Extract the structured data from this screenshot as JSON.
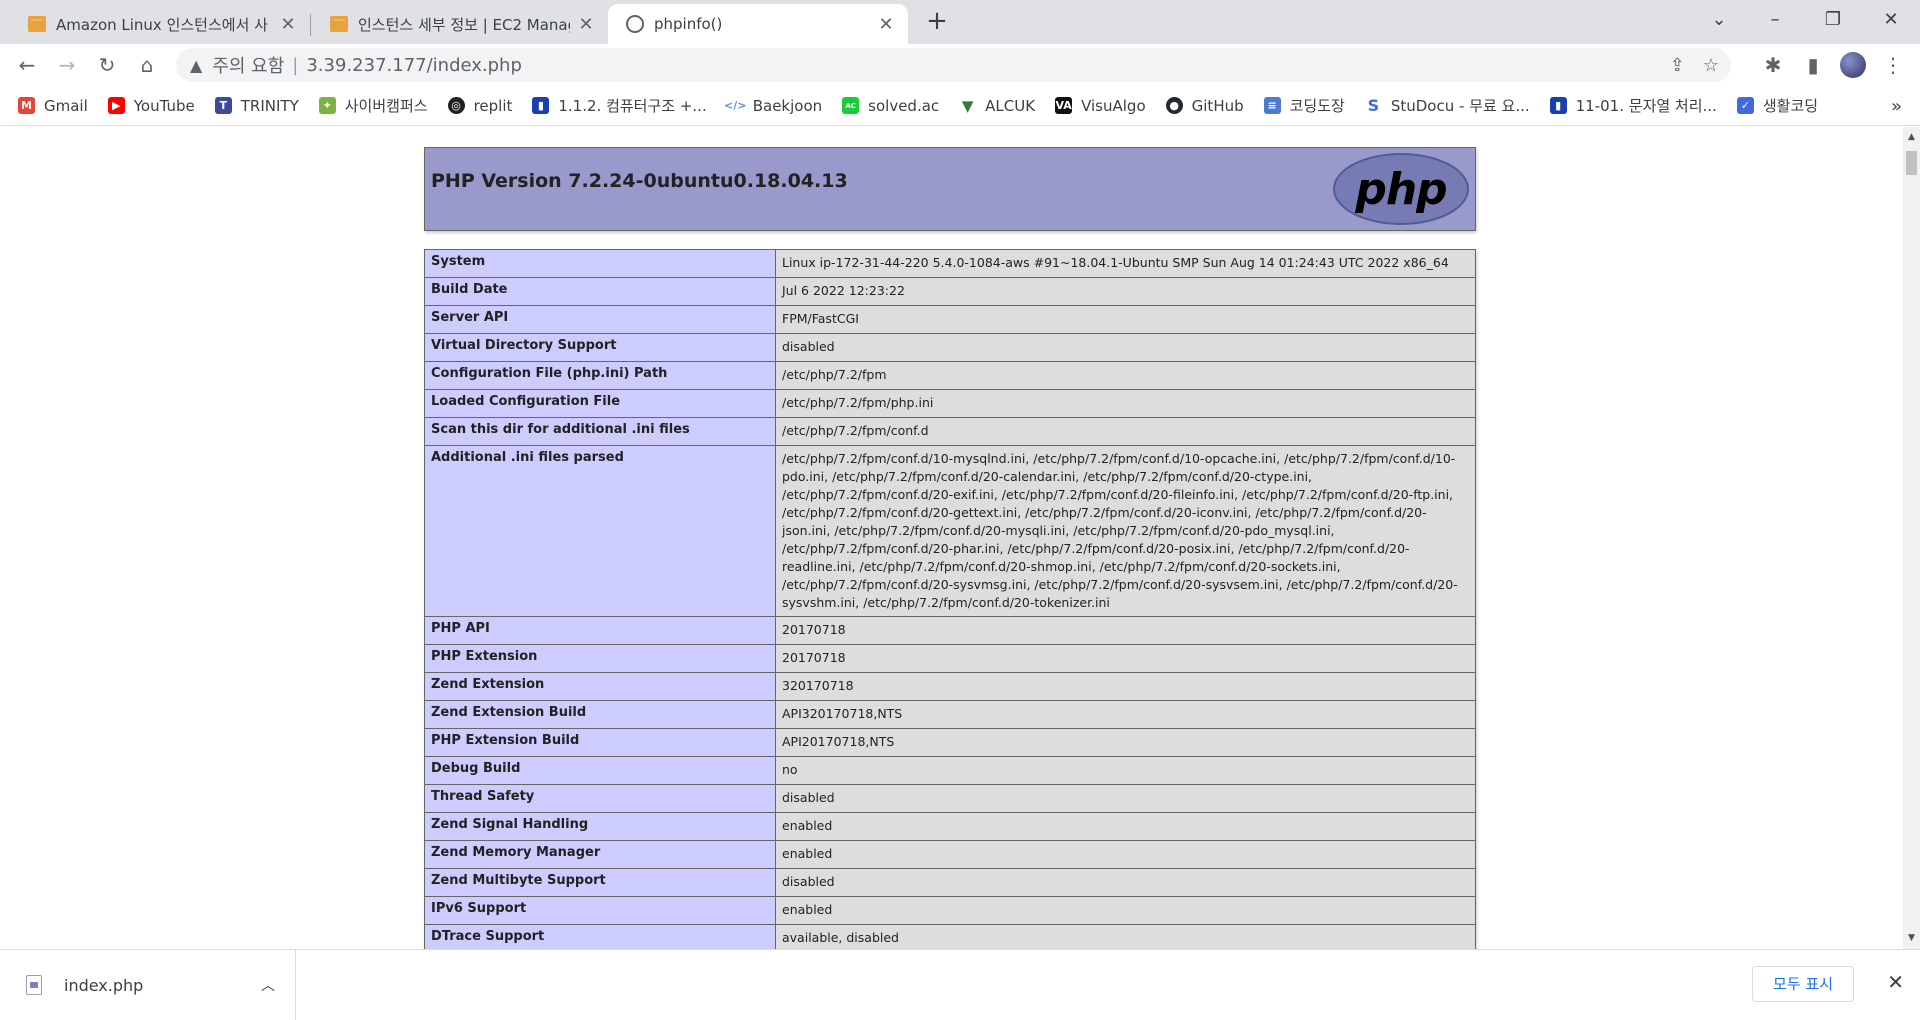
{
  "tabs": [
    {
      "title": "Amazon Linux 인스턴스에서 사용",
      "icon": "aws-box-icon",
      "active": false
    },
    {
      "title": "인스턴스 세부 정보 | EC2 Manag",
      "icon": "aws-box-icon",
      "active": false
    },
    {
      "title": "phpinfo()",
      "icon": "globe-icon",
      "active": true
    }
  ],
  "toolbar": {
    "security_label": "주의 요함",
    "url": "3.39.237.177/index.php"
  },
  "bookmarks": [
    {
      "label": "Gmail",
      "icon": "gmail-icon",
      "color": "#ea4335"
    },
    {
      "label": "YouTube",
      "icon": "youtube-icon",
      "color": "#ff0000"
    },
    {
      "label": "TRINITY",
      "icon": "trinity-icon",
      "color": "#3b4a9c"
    },
    {
      "label": "사이버캠퍼스",
      "icon": "cybercampus-icon",
      "color": "#7cb342"
    },
    {
      "label": "replit",
      "icon": "replit-icon",
      "color": "#202124"
    },
    {
      "label": "1.1.2. 컴퓨터구조 +...",
      "icon": "book-icon",
      "color": "#1a3fb0"
    },
    {
      "label": "Baekjoon",
      "icon": "code-icon",
      "color": "#5b8dd9"
    },
    {
      "label": "solved.ac",
      "icon": "solvedac-icon",
      "color": "#17ce3a"
    },
    {
      "label": "ALCUK",
      "icon": "alcuk-icon",
      "color": "#2e7d32"
    },
    {
      "label": "VisuAlgo",
      "icon": "visualgo-icon",
      "color": "#111111"
    },
    {
      "label": "GitHub",
      "icon": "github-icon",
      "color": "#24292e"
    },
    {
      "label": "코딩도장",
      "icon": "dojang-icon",
      "color": "#4a7bd0"
    },
    {
      "label": "StuDocu - 무료 요...",
      "icon": "studocu-icon",
      "color": "#3a6fd8"
    },
    {
      "label": "11-01. 문자열 처리...",
      "icon": "book-icon",
      "color": "#1a3fb0"
    },
    {
      "label": "생활코딩",
      "icon": "opentutorials-icon",
      "color": "#4169e1"
    }
  ],
  "php": {
    "version_title": "PHP Version 7.2.24-0ubuntu0.18.04.13",
    "logo_text": "php",
    "rows": [
      {
        "key": "System",
        "value": "Linux ip-172-31-44-220 5.4.0-1084-aws #91~18.04.1-Ubuntu SMP Sun Aug 14 01:24:43 UTC 2022 x86_64"
      },
      {
        "key": "Build Date",
        "value": "Jul 6 2022 12:23:22"
      },
      {
        "key": "Server API",
        "value": "FPM/FastCGI"
      },
      {
        "key": "Virtual Directory Support",
        "value": "disabled"
      },
      {
        "key": "Configuration File (php.ini) Path",
        "value": "/etc/php/7.2/fpm"
      },
      {
        "key": "Loaded Configuration File",
        "value": "/etc/php/7.2/fpm/php.ini"
      },
      {
        "key": "Scan this dir for additional .ini files",
        "value": "/etc/php/7.2/fpm/conf.d"
      },
      {
        "key": "Additional .ini files parsed",
        "value": "/etc/php/7.2/fpm/conf.d/10-mysqlnd.ini, /etc/php/7.2/fpm/conf.d/10-opcache.ini, /etc/php/7.2/fpm/conf.d/10-pdo.ini, /etc/php/7.2/fpm/conf.d/20-calendar.ini, /etc/php/7.2/fpm/conf.d/20-ctype.ini, /etc/php/7.2/fpm/conf.d/20-exif.ini, /etc/php/7.2/fpm/conf.d/20-fileinfo.ini, /etc/php/7.2/fpm/conf.d/20-ftp.ini, /etc/php/7.2/fpm/conf.d/20-gettext.ini, /etc/php/7.2/fpm/conf.d/20-iconv.ini, /etc/php/7.2/fpm/conf.d/20-json.ini, /etc/php/7.2/fpm/conf.d/20-mysqli.ini, /etc/php/7.2/fpm/conf.d/20-pdo_mysql.ini, /etc/php/7.2/fpm/conf.d/20-phar.ini, /etc/php/7.2/fpm/conf.d/20-posix.ini, /etc/php/7.2/fpm/conf.d/20-readline.ini, /etc/php/7.2/fpm/conf.d/20-shmop.ini, /etc/php/7.2/fpm/conf.d/20-sockets.ini, /etc/php/7.2/fpm/conf.d/20-sysvmsg.ini, /etc/php/7.2/fpm/conf.d/20-sysvsem.ini, /etc/php/7.2/fpm/conf.d/20-sysvshm.ini, /etc/php/7.2/fpm/conf.d/20-tokenizer.ini"
      },
      {
        "key": "PHP API",
        "value": "20170718"
      },
      {
        "key": "PHP Extension",
        "value": "20170718"
      },
      {
        "key": "Zend Extension",
        "value": "320170718"
      },
      {
        "key": "Zend Extension Build",
        "value": "API320170718,NTS"
      },
      {
        "key": "PHP Extension Build",
        "value": "API20170718,NTS"
      },
      {
        "key": "Debug Build",
        "value": "no"
      },
      {
        "key": "Thread Safety",
        "value": "disabled"
      },
      {
        "key": "Zend Signal Handling",
        "value": "enabled"
      },
      {
        "key": "Zend Memory Manager",
        "value": "enabled"
      },
      {
        "key": "Zend Multibyte Support",
        "value": "disabled"
      },
      {
        "key": "IPv6 Support",
        "value": "enabled"
      },
      {
        "key": "DTrace Support",
        "value": "available, disabled"
      }
    ]
  },
  "downloads": {
    "file_name": "index.php",
    "show_all_label": "모두 표시"
  }
}
